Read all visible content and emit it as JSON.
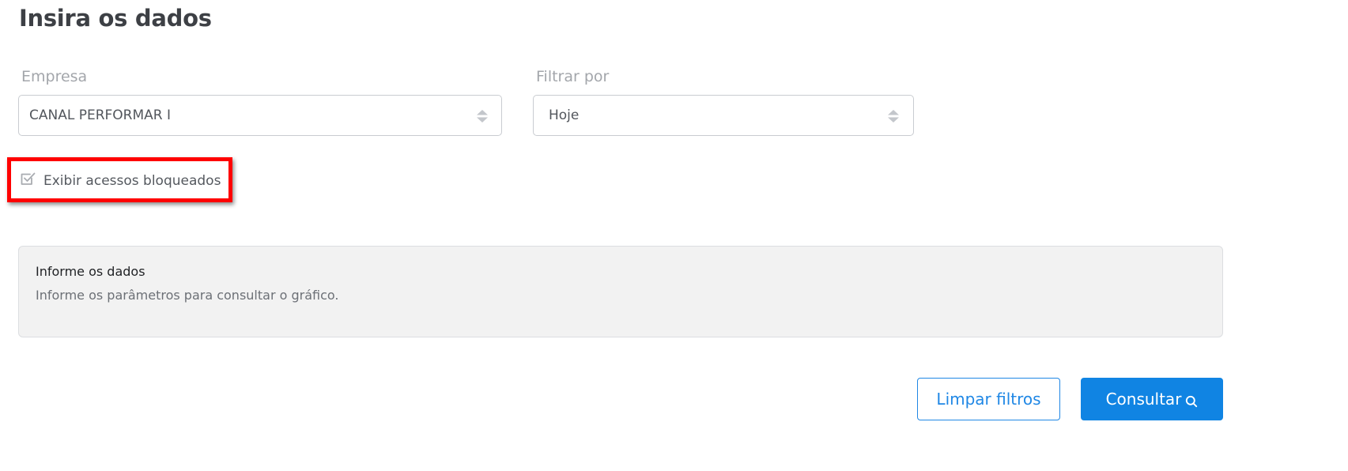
{
  "page": {
    "title": "Insira os dados"
  },
  "filters": {
    "empresa": {
      "label": "Empresa",
      "value": "CANAL PERFORMAR I"
    },
    "filtrar_por": {
      "label": "Filtrar por",
      "value": "Hoje"
    },
    "show_blocked": {
      "label": "Exibir acessos bloqueados",
      "checked": true
    }
  },
  "info": {
    "title": "Informe os dados",
    "text": "Informe os parâmetros para consultar o gráfico."
  },
  "actions": {
    "clear_label": "Limpar filtros",
    "submit_label": "Consultar"
  },
  "colors": {
    "primary": "#1084e3",
    "highlight": "#ff0000",
    "panel_bg": "#f2f2f2"
  },
  "icons": {
    "select_arrows": "up-down-caret-icon",
    "checkbox": "checkbox-checked-icon",
    "search": "search-icon"
  }
}
